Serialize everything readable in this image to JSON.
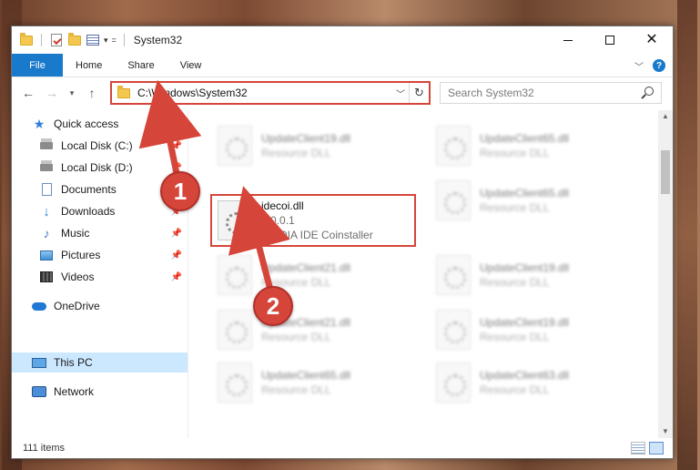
{
  "window": {
    "title": "System32",
    "controls": {
      "minimize": "minimize",
      "maximize": "maximize",
      "close": "close"
    }
  },
  "ribbon": {
    "tabs": [
      "File",
      "Home",
      "Share",
      "View"
    ],
    "help": "?"
  },
  "navigation": {
    "address": "C:\\Windows\\System32",
    "search_placeholder": "Search System32"
  },
  "sidebar": {
    "items": [
      {
        "label": "Quick access",
        "icon": "star-icon",
        "pinned": false
      },
      {
        "label": "Local Disk (C:)",
        "icon": "drive-icon",
        "pinned": true
      },
      {
        "label": "Local Disk (D:)",
        "icon": "drive-icon",
        "pinned": true
      },
      {
        "label": "Documents",
        "icon": "documents-icon",
        "pinned": true
      },
      {
        "label": "Downloads",
        "icon": "downloads-icon",
        "pinned": true
      },
      {
        "label": "Music",
        "icon": "music-icon",
        "pinned": true
      },
      {
        "label": "Pictures",
        "icon": "pictures-icon",
        "pinned": true
      },
      {
        "label": "Videos",
        "icon": "videos-icon",
        "pinned": true
      },
      {
        "label": "OneDrive",
        "icon": "onedrive-icon",
        "pinned": false
      },
      {
        "label": "This PC",
        "icon": "this-pc-icon",
        "pinned": false,
        "selected": true
      },
      {
        "label": "Network",
        "icon": "network-icon",
        "pinned": false
      }
    ]
  },
  "files": [
    {
      "name": "UpdateClient19.dll",
      "sub": "Resource DLL",
      "blurred": true
    },
    {
      "name": "UpdateClient65.dll",
      "sub": "Resource DLL",
      "blurred": true
    },
    {
      "name": "idecoi.dll",
      "version": "1.0.0.1",
      "description": "NVIDIA IDE Coinstaller",
      "blurred": false
    },
    {
      "name": "UpdateClient65.dll",
      "sub": "Resource DLL",
      "blurred": true
    },
    {
      "name": "UpdateClient21.dll",
      "sub": "Resource DLL",
      "blurred": true
    },
    {
      "name": "UpdateClient19.dll",
      "sub": "Resource DLL",
      "blurred": true
    },
    {
      "name": "UpdateClient21.dll",
      "sub": "Resource DLL",
      "blurred": true
    },
    {
      "name": "UpdateClient19.dll",
      "sub": "Resource DLL",
      "blurred": true
    },
    {
      "name": "UpdateClient65.dll",
      "sub": "Resource DLL",
      "blurred": true
    },
    {
      "name": "UpdateClient63.dll",
      "sub": "Resource DLL",
      "blurred": true
    }
  ],
  "status": {
    "item_count": "111 items"
  },
  "annotations": {
    "badge_1": "1",
    "badge_2": "2",
    "color": "#d6453a"
  },
  "colors": {
    "file_tab": "#1979ca",
    "selected_item": "#cce8ff",
    "highlight": "#d6453a"
  }
}
